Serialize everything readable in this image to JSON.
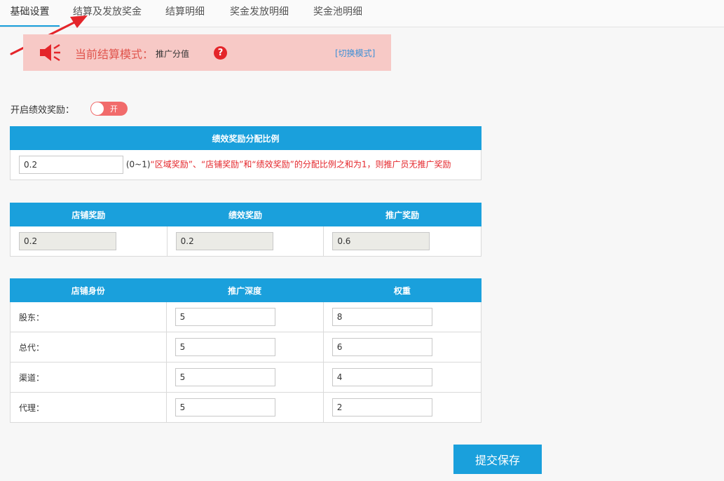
{
  "tabs": [
    {
      "label": "基础设置",
      "active": true
    },
    {
      "label": "结算及发放奖金",
      "active": false
    },
    {
      "label": "结算明细",
      "active": false
    },
    {
      "label": "奖金发放明细",
      "active": false
    },
    {
      "label": "奖金池明细",
      "active": false
    }
  ],
  "banner": {
    "mode_label": "当前结算模式：",
    "mode_value": "推广分值",
    "help_glyph": "?",
    "switch_label": "[切换模式]",
    "speaker_icon": "speaker-icon"
  },
  "toggle": {
    "label": "开启绩效奖励：",
    "state": "开",
    "on": true
  },
  "ratio": {
    "header": "绩效奖励分配比例",
    "value": "0.2",
    "range": "(0~1)",
    "hint": "“区域奖励”、“店铺奖励”和“绩效奖励”的分配比例之和为1，则推广员无推广奖励"
  },
  "rewards": {
    "headers": [
      "店铺奖励",
      "绩效奖励",
      "推广奖励"
    ],
    "values": [
      "0.2",
      "0.2",
      "0.6"
    ]
  },
  "identity": {
    "headers": [
      "店铺身份",
      "推广深度",
      "权重"
    ],
    "rows": [
      {
        "name": "股东：",
        "depth": "5",
        "weight": "8"
      },
      {
        "name": "总代：",
        "depth": "5",
        "weight": "6"
      },
      {
        "name": "渠道：",
        "depth": "5",
        "weight": "4"
      },
      {
        "name": "代理：",
        "depth": "5",
        "weight": "2"
      }
    ]
  },
  "submit_label": "提交保存",
  "colors": {
    "accent": "#1aa0dc",
    "banner_bg": "#f7c9c6",
    "alert": "#e4252a",
    "toggle_on": "#f16b6b"
  }
}
